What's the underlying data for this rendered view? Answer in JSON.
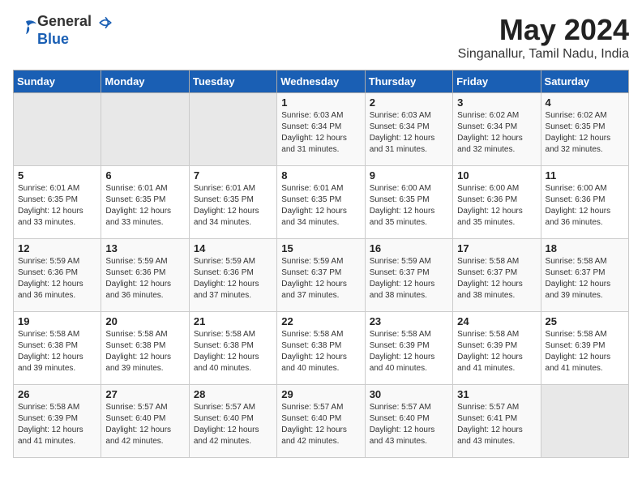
{
  "header": {
    "logo_general": "General",
    "logo_blue": "Blue",
    "title": "May 2024",
    "location": "Singanallur, Tamil Nadu, India"
  },
  "weekdays": [
    "Sunday",
    "Monday",
    "Tuesday",
    "Wednesday",
    "Thursday",
    "Friday",
    "Saturday"
  ],
  "weeks": [
    [
      {
        "day": "",
        "empty": true
      },
      {
        "day": "",
        "empty": true
      },
      {
        "day": "",
        "empty": true
      },
      {
        "day": "1",
        "sunrise": "6:03 AM",
        "sunset": "6:34 PM",
        "daylight": "12 hours and 31 minutes."
      },
      {
        "day": "2",
        "sunrise": "6:03 AM",
        "sunset": "6:34 PM",
        "daylight": "12 hours and 31 minutes."
      },
      {
        "day": "3",
        "sunrise": "6:02 AM",
        "sunset": "6:34 PM",
        "daylight": "12 hours and 32 minutes."
      },
      {
        "day": "4",
        "sunrise": "6:02 AM",
        "sunset": "6:35 PM",
        "daylight": "12 hours and 32 minutes."
      }
    ],
    [
      {
        "day": "5",
        "sunrise": "6:01 AM",
        "sunset": "6:35 PM",
        "daylight": "12 hours and 33 minutes."
      },
      {
        "day": "6",
        "sunrise": "6:01 AM",
        "sunset": "6:35 PM",
        "daylight": "12 hours and 33 minutes."
      },
      {
        "day": "7",
        "sunrise": "6:01 AM",
        "sunset": "6:35 PM",
        "daylight": "12 hours and 34 minutes."
      },
      {
        "day": "8",
        "sunrise": "6:01 AM",
        "sunset": "6:35 PM",
        "daylight": "12 hours and 34 minutes."
      },
      {
        "day": "9",
        "sunrise": "6:00 AM",
        "sunset": "6:35 PM",
        "daylight": "12 hours and 35 minutes."
      },
      {
        "day": "10",
        "sunrise": "6:00 AM",
        "sunset": "6:36 PM",
        "daylight": "12 hours and 35 minutes."
      },
      {
        "day": "11",
        "sunrise": "6:00 AM",
        "sunset": "6:36 PM",
        "daylight": "12 hours and 36 minutes."
      }
    ],
    [
      {
        "day": "12",
        "sunrise": "5:59 AM",
        "sunset": "6:36 PM",
        "daylight": "12 hours and 36 minutes."
      },
      {
        "day": "13",
        "sunrise": "5:59 AM",
        "sunset": "6:36 PM",
        "daylight": "12 hours and 36 minutes."
      },
      {
        "day": "14",
        "sunrise": "5:59 AM",
        "sunset": "6:36 PM",
        "daylight": "12 hours and 37 minutes."
      },
      {
        "day": "15",
        "sunrise": "5:59 AM",
        "sunset": "6:37 PM",
        "daylight": "12 hours and 37 minutes."
      },
      {
        "day": "16",
        "sunrise": "5:59 AM",
        "sunset": "6:37 PM",
        "daylight": "12 hours and 38 minutes."
      },
      {
        "day": "17",
        "sunrise": "5:58 AM",
        "sunset": "6:37 PM",
        "daylight": "12 hours and 38 minutes."
      },
      {
        "day": "18",
        "sunrise": "5:58 AM",
        "sunset": "6:37 PM",
        "daylight": "12 hours and 39 minutes."
      }
    ],
    [
      {
        "day": "19",
        "sunrise": "5:58 AM",
        "sunset": "6:38 PM",
        "daylight": "12 hours and 39 minutes."
      },
      {
        "day": "20",
        "sunrise": "5:58 AM",
        "sunset": "6:38 PM",
        "daylight": "12 hours and 39 minutes."
      },
      {
        "day": "21",
        "sunrise": "5:58 AM",
        "sunset": "6:38 PM",
        "daylight": "12 hours and 40 minutes."
      },
      {
        "day": "22",
        "sunrise": "5:58 AM",
        "sunset": "6:38 PM",
        "daylight": "12 hours and 40 minutes."
      },
      {
        "day": "23",
        "sunrise": "5:58 AM",
        "sunset": "6:39 PM",
        "daylight": "12 hours and 40 minutes."
      },
      {
        "day": "24",
        "sunrise": "5:58 AM",
        "sunset": "6:39 PM",
        "daylight": "12 hours and 41 minutes."
      },
      {
        "day": "25",
        "sunrise": "5:58 AM",
        "sunset": "6:39 PM",
        "daylight": "12 hours and 41 minutes."
      }
    ],
    [
      {
        "day": "26",
        "sunrise": "5:58 AM",
        "sunset": "6:39 PM",
        "daylight": "12 hours and 41 minutes."
      },
      {
        "day": "27",
        "sunrise": "5:57 AM",
        "sunset": "6:40 PM",
        "daylight": "12 hours and 42 minutes."
      },
      {
        "day": "28",
        "sunrise": "5:57 AM",
        "sunset": "6:40 PM",
        "daylight": "12 hours and 42 minutes."
      },
      {
        "day": "29",
        "sunrise": "5:57 AM",
        "sunset": "6:40 PM",
        "daylight": "12 hours and 42 minutes."
      },
      {
        "day": "30",
        "sunrise": "5:57 AM",
        "sunset": "6:40 PM",
        "daylight": "12 hours and 43 minutes."
      },
      {
        "day": "31",
        "sunrise": "5:57 AM",
        "sunset": "6:41 PM",
        "daylight": "12 hours and 43 minutes."
      },
      {
        "day": "",
        "empty": true
      }
    ]
  ],
  "labels": {
    "sunrise_prefix": "Sunrise: ",
    "sunset_prefix": "Sunset: ",
    "daylight_prefix": "Daylight: "
  }
}
